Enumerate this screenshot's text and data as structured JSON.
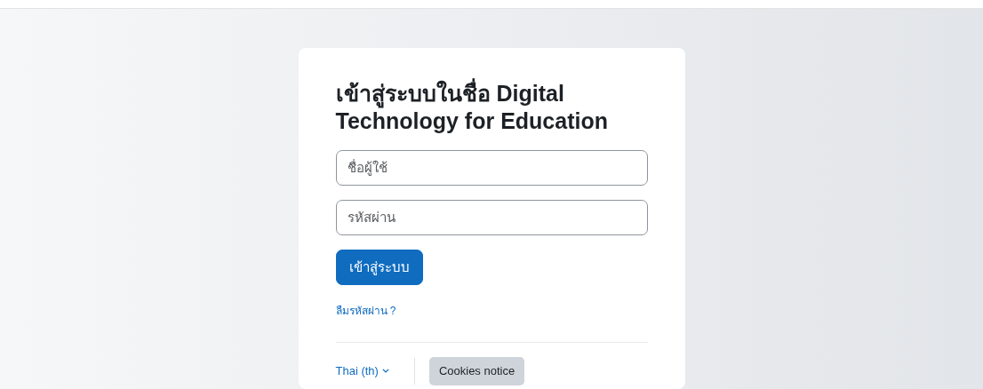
{
  "login": {
    "title": "เข้าสู่ระบบในชื่อ Digital Technology for Education",
    "username": {
      "placeholder": "ชื่อผู้ใช้"
    },
    "password": {
      "placeholder": "รหัสผ่าน"
    },
    "submit": "เข้าสู่ระบบ",
    "forgot_link": "ลืมรหัสผ่าน ?",
    "language": "Thai (th)",
    "cookies_button": "Cookies notice"
  }
}
